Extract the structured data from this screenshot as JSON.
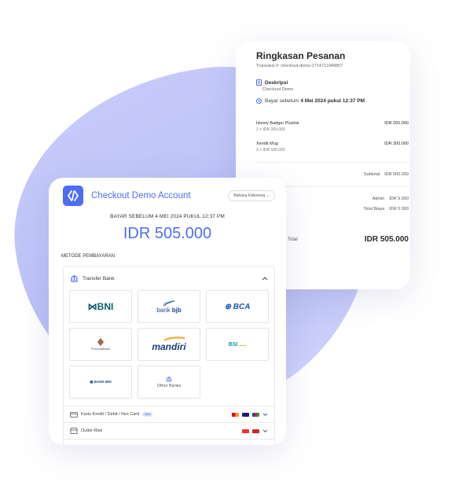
{
  "summary": {
    "title": "Ringkasan Pesanan",
    "transaction": "Transaksi #: checkout-demo-1714711048857",
    "description_label": "Deskripsi",
    "description_value": "Checkout Demo",
    "due_prefix": "Bayar sebelum",
    "due_date": "4 Mei 2024 pukul 12:37 PM",
    "items": [
      {
        "name": "Honey Badger Plushie",
        "qty": "1 × IDR 200.000",
        "price": "IDR 200.000"
      },
      {
        "name": "Xendit Mug",
        "qty": "3 × IDR 100.000",
        "price": "IDR 300.000"
      }
    ],
    "subtotal_label": "Subtotal",
    "subtotal_value": "IDR 500.000",
    "admin_label": "Admin",
    "admin_value": "IDR 5.000",
    "total_fee_label": "Total Biaya",
    "total_fee_value": "IDR 5.000",
    "total_label": "Total",
    "total_value": "IDR 505.000"
  },
  "checkout": {
    "account": "Checkout Demo Account",
    "language": "Bahasa Indonesia ⌄",
    "due": "BAYAR SEBELUM 4 MEI 2024 PUKUL 12:37 PM",
    "amount": "IDR 505.000",
    "method_label": "METODE PEMBAYARAN",
    "transfer_label": "Transfer Bank",
    "banks": {
      "bni": "BNI",
      "bjb_prefix": "bank",
      "bjb_suffix": "bjb",
      "bca": "BCA",
      "permata": "PermataBank",
      "mandiri": "mandiri",
      "bsi": "BSI",
      "bri": "BANK BRI",
      "other": "Other Banks"
    },
    "card_label": "Kartu Kredit / Debit / Nex Card",
    "card_badge": "New",
    "outlet_label": "Outlet Ritel"
  },
  "colors": {
    "accent": "#4c6ef5",
    "blob": "#c3c8fa"
  }
}
